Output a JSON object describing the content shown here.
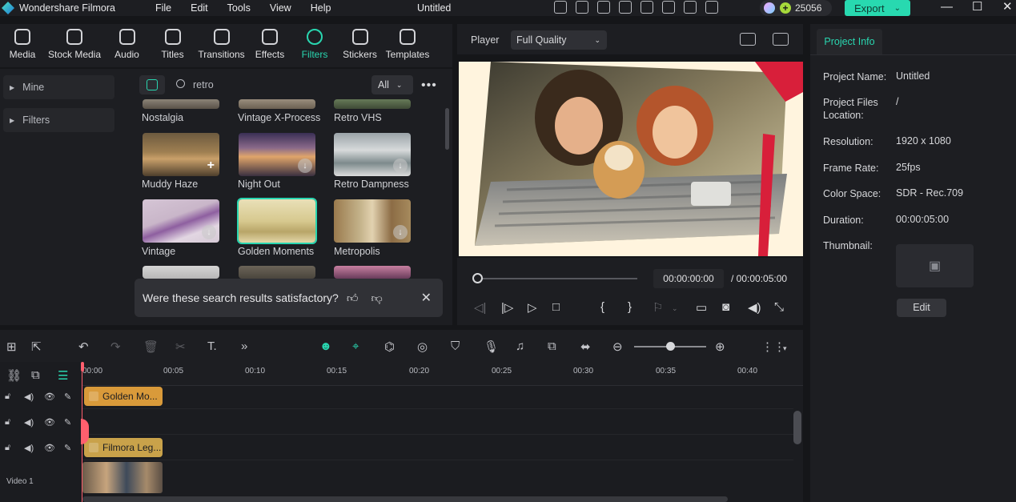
{
  "titlebar": {
    "app_name": "Wondershare Filmora",
    "menu": [
      "File",
      "Edit",
      "Tools",
      "View",
      "Help"
    ],
    "doc_title": "Untitled",
    "credits": "25056",
    "export_label": "Export"
  },
  "media_tabs": [
    {
      "label": "Media",
      "active": false
    },
    {
      "label": "Stock Media",
      "active": false
    },
    {
      "label": "Audio",
      "active": false
    },
    {
      "label": "Titles",
      "active": false
    },
    {
      "label": "Transitions",
      "active": false
    },
    {
      "label": "Effects",
      "active": false
    },
    {
      "label": "Filters",
      "active": true
    },
    {
      "label": "Stickers",
      "active": false
    },
    {
      "label": "Templates",
      "active": false
    }
  ],
  "sidebar": {
    "items": [
      {
        "label": "Mine"
      },
      {
        "label": "Filters"
      }
    ]
  },
  "search": {
    "query": "retro",
    "filter_value": "All"
  },
  "filters_grid": [
    {
      "name": "Nostalgia"
    },
    {
      "name": "Vintage X-Process"
    },
    {
      "name": "Retro VHS"
    },
    {
      "name": "Muddy Haze",
      "status": "add"
    },
    {
      "name": "Night Out",
      "status": "download"
    },
    {
      "name": "Retro Dampness",
      "status": "download"
    },
    {
      "name": "Vintage",
      "status": "download"
    },
    {
      "name": "Golden Moments",
      "selected": true
    },
    {
      "name": "Metropolis",
      "status": "download"
    }
  ],
  "feedback": {
    "question": "Were these search results satisfactory?"
  },
  "player": {
    "label": "Player",
    "quality": "Full Quality",
    "current_time": "00:00:00:00",
    "total_time": "/  00:00:05:00"
  },
  "project_info": {
    "tab_label": "Project Info",
    "fields": [
      {
        "label": "Project Name:",
        "value": "Untitled"
      },
      {
        "label": "Project Files Location:",
        "value": "/"
      },
      {
        "label": "Resolution:",
        "value": "1920 x 1080"
      },
      {
        "label": "Frame Rate:",
        "value": "25fps"
      },
      {
        "label": "Color Space:",
        "value": "SDR - Rec.709"
      },
      {
        "label": "Duration:",
        "value": "00:00:05:00"
      },
      {
        "label": "Thumbnail:",
        "value": ""
      }
    ],
    "edit_label": "Edit"
  },
  "timeline": {
    "ruler": [
      "00:00",
      "00:05",
      "00:10",
      "00:15",
      "00:20",
      "00:25",
      "00:30",
      "00:35",
      "00:40"
    ],
    "clips": [
      {
        "label": "Golden Mo...",
        "color": "#d99a3a"
      },
      {
        "label": "Filmora Leg...",
        "color": "#c9a24a"
      }
    ],
    "video_track_label": "Video 1"
  },
  "colors": {
    "accent": "#29d6b0",
    "playhead": "#ff5f6e"
  }
}
